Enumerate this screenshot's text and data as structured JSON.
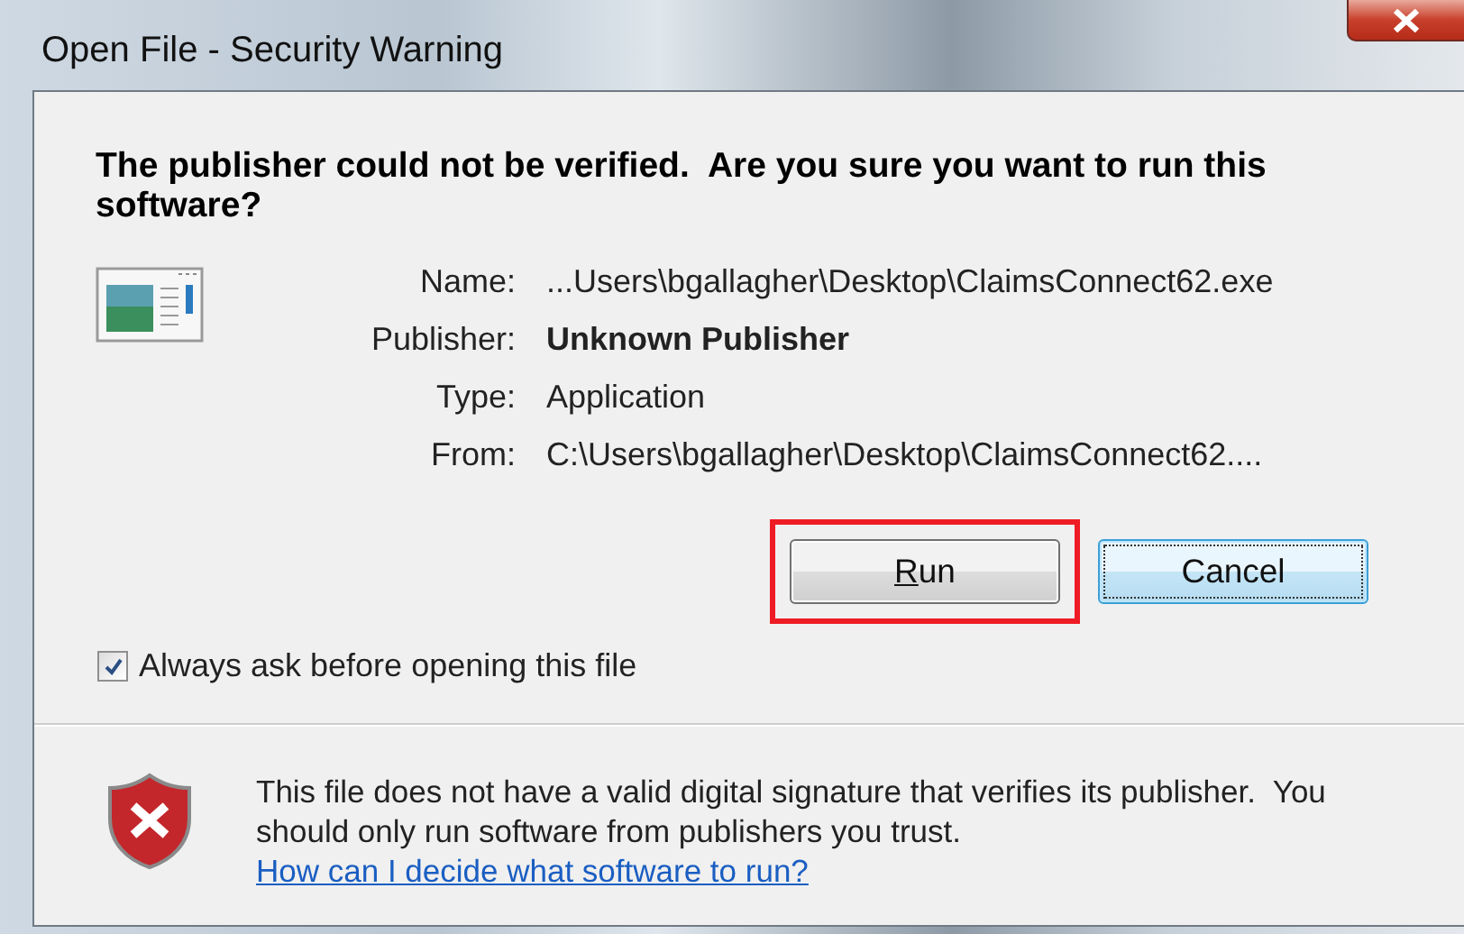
{
  "window": {
    "title": "Open File - Security Warning"
  },
  "heading": "The publisher could not be verified.  Are you sure you want to run this software?",
  "details": [
    {
      "label": "Name:",
      "value": "...Users\\bgallagher\\Desktop\\ClaimsConnect62.exe",
      "bold": false
    },
    {
      "label": "Publisher:",
      "value": "Unknown Publisher",
      "bold": true
    },
    {
      "label": "Type:",
      "value": "Application",
      "bold": false
    },
    {
      "label": "From:",
      "value": "C:\\Users\\bgallagher\\Desktop\\ClaimsConnect62....",
      "bold": false
    }
  ],
  "buttons": [
    {
      "label": "Run",
      "highlighted": true,
      "focused": false,
      "mnemonic": true
    },
    {
      "label": "Cancel",
      "highlighted": false,
      "focused": true,
      "mnemonic": false
    }
  ],
  "checkbox": {
    "label": "Always ask before opening this file",
    "checked": true
  },
  "footer": {
    "text": "This file does not have a valid digital signature that verifies its publisher.  You should only run software from publishers you trust.",
    "link": "How can I decide what software to run?"
  }
}
